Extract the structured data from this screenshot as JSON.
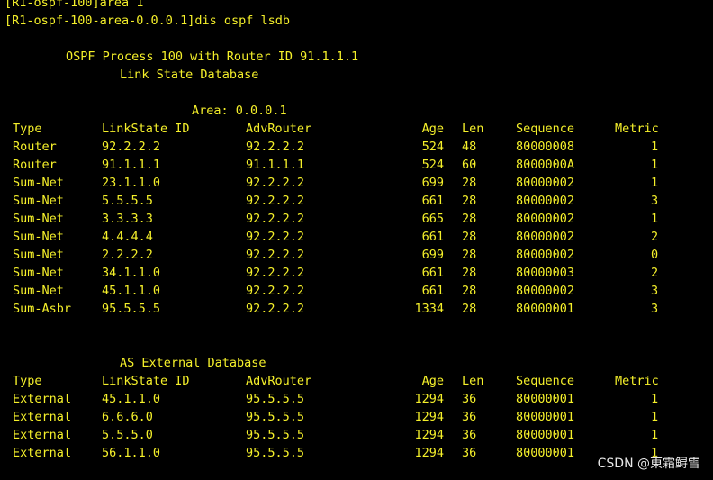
{
  "terminal": {
    "lines": {
      "prompt_area": "[R1-ospf-100]area 1",
      "prompt_cmd": "[R1-ospf-100-area-0.0.0.1]dis ospf lsdb",
      "process_header": "OSPF Process 100 with Router ID 91.1.1.1",
      "lsdb_title": "Link State Database",
      "area_label": "Area: 0.0.0.1",
      "external_title": "AS External Database"
    },
    "headers": {
      "type": "Type",
      "linkstate_id": "LinkState ID",
      "adv_router": "AdvRouter",
      "age": "Age",
      "len": "Len",
      "sequence": "Sequence",
      "metric": "Metric"
    },
    "area_rows": [
      {
        "type": "Router",
        "id": "92.2.2.2",
        "adv": "92.2.2.2",
        "age": "524",
        "len": "48",
        "seq": "80000008",
        "metric": "1"
      },
      {
        "type": "Router",
        "id": "91.1.1.1",
        "adv": "91.1.1.1",
        "age": "524",
        "len": "60",
        "seq": "8000000A",
        "metric": "1"
      },
      {
        "type": "Sum-Net",
        "id": "23.1.1.0",
        "adv": "92.2.2.2",
        "age": "699",
        "len": "28",
        "seq": "80000002",
        "metric": "1"
      },
      {
        "type": "Sum-Net",
        "id": "5.5.5.5",
        "adv": "92.2.2.2",
        "age": "661",
        "len": "28",
        "seq": "80000002",
        "metric": "3"
      },
      {
        "type": "Sum-Net",
        "id": "3.3.3.3",
        "adv": "92.2.2.2",
        "age": "665",
        "len": "28",
        "seq": "80000002",
        "metric": "1"
      },
      {
        "type": "Sum-Net",
        "id": "4.4.4.4",
        "adv": "92.2.2.2",
        "age": "661",
        "len": "28",
        "seq": "80000002",
        "metric": "2"
      },
      {
        "type": "Sum-Net",
        "id": "2.2.2.2",
        "adv": "92.2.2.2",
        "age": "699",
        "len": "28",
        "seq": "80000002",
        "metric": "0"
      },
      {
        "type": "Sum-Net",
        "id": "34.1.1.0",
        "adv": "92.2.2.2",
        "age": "661",
        "len": "28",
        "seq": "80000003",
        "metric": "2"
      },
      {
        "type": "Sum-Net",
        "id": "45.1.1.0",
        "adv": "92.2.2.2",
        "age": "661",
        "len": "28",
        "seq": "80000002",
        "metric": "3"
      },
      {
        "type": "Sum-Asbr",
        "id": "95.5.5.5",
        "adv": "92.2.2.2",
        "age": "1334",
        "len": "28",
        "seq": "80000001",
        "metric": "3"
      }
    ],
    "external_rows": [
      {
        "type": "External",
        "id": "45.1.1.0",
        "adv": "95.5.5.5",
        "age": "1294",
        "len": "36",
        "seq": "80000001",
        "metric": "1"
      },
      {
        "type": "External",
        "id": "6.6.6.0",
        "adv": "95.5.5.5",
        "age": "1294",
        "len": "36",
        "seq": "80000001",
        "metric": "1"
      },
      {
        "type": "External",
        "id": "5.5.5.0",
        "adv": "95.5.5.5",
        "age": "1294",
        "len": "36",
        "seq": "80000001",
        "metric": "1"
      },
      {
        "type": "External",
        "id": "56.1.1.0",
        "adv": "95.5.5.5",
        "age": "1294",
        "len": "36",
        "seq": "80000001",
        "metric": "1"
      }
    ],
    "text_color": "#f5f02a",
    "background_color": "#000000"
  },
  "watermark": {
    "text": "CSDN @東霜鲟雪"
  }
}
